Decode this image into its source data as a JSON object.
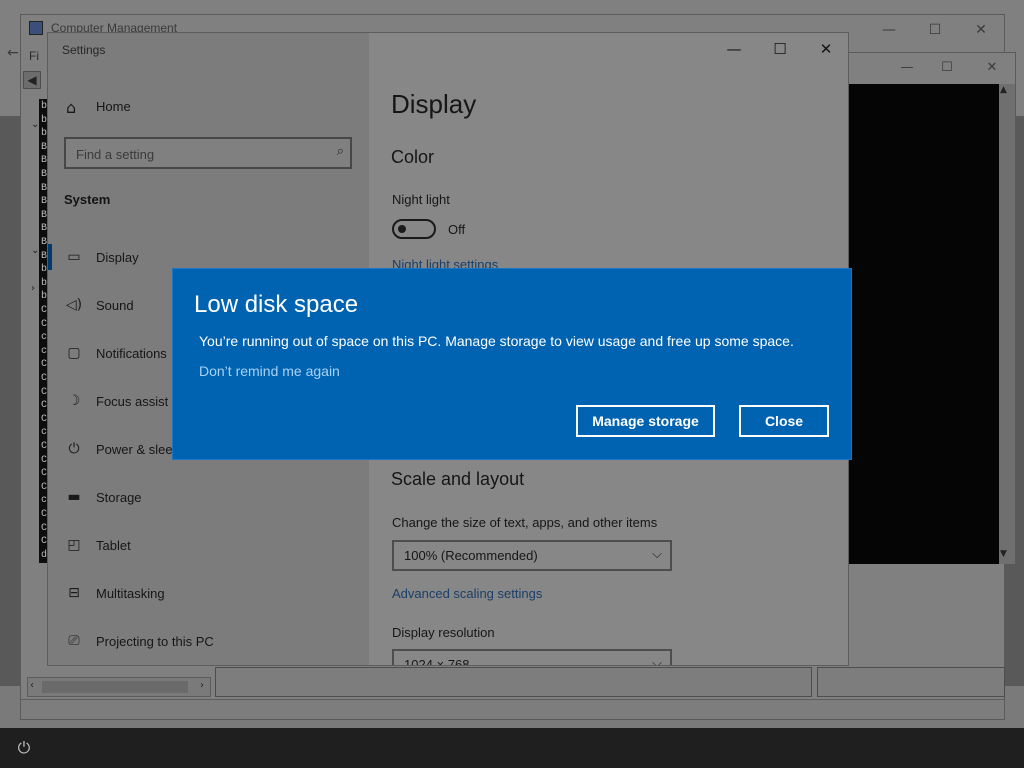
{
  "background": {
    "computer_management": {
      "title": "Computer Management",
      "menu_first_letter": "Fi",
      "controls": {
        "minimize": "—",
        "maximize": "☐",
        "close": "✕"
      },
      "tree_letters": [
        "b",
        "b",
        "b",
        "B",
        "B",
        "B",
        "B",
        "B",
        "B",
        "B",
        "B",
        "B",
        "b",
        "b",
        "b",
        "C",
        "C",
        "c",
        "c",
        "C",
        "C",
        "C",
        "C",
        "C",
        "c",
        "C",
        "C",
        "C",
        "C",
        "c",
        "C",
        "C",
        "C",
        "d"
      ]
    },
    "console": {
      "controls": {
        "minimize": "—",
        "maximize": "☐",
        "close": "✕"
      }
    }
  },
  "settings": {
    "title": "Settings",
    "controls": {
      "minimize": "—",
      "maximize": "☐",
      "close": "✕"
    },
    "home": "Home",
    "search_placeholder": "Find a setting",
    "section": "System",
    "nav": [
      {
        "label": "Display",
        "icon": "display-icon"
      },
      {
        "label": "Sound",
        "icon": "sound-icon"
      },
      {
        "label": "Notifications",
        "icon": "notifications-icon"
      },
      {
        "label": "Focus assist",
        "icon": "focus-assist-icon"
      },
      {
        "label": "Power & slee",
        "icon": "power-icon"
      },
      {
        "label": "Storage",
        "icon": "storage-icon"
      },
      {
        "label": "Tablet",
        "icon": "tablet-icon"
      },
      {
        "label": "Multitasking",
        "icon": "multitasking-icon"
      },
      {
        "label": "Projecting to this PC",
        "icon": "projecting-icon"
      }
    ],
    "main": {
      "title": "Display",
      "color_heading": "Color",
      "night_light_label": "Night light",
      "night_light_state": "Off",
      "night_light_link": "Night light settings",
      "scale_heading": "Scale and layout",
      "scale_desc": "Change the size of text, apps, and other items",
      "scale_value": "100% (Recommended)",
      "advanced_link": "Advanced scaling settings",
      "resolution_label": "Display resolution",
      "resolution_value": "1024 × 768"
    }
  },
  "dialog": {
    "title": "Low disk space",
    "message": "You’re running out of space on this PC. Manage storage to view usage and free up some space.",
    "link": "Don’t remind me again",
    "primary_button": "Manage storage",
    "secondary_button": "Close"
  },
  "colors": {
    "dialog_bg": "#0063b1",
    "dialog_text": "#ffffff",
    "link": "#a8d2f5"
  }
}
